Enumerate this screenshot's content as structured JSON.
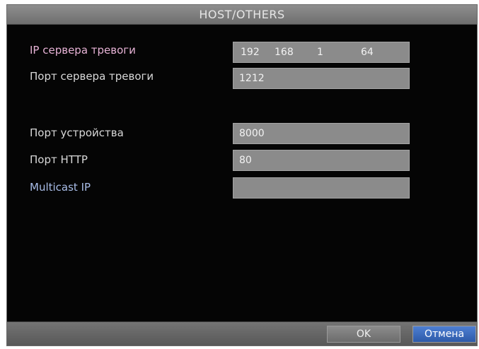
{
  "window": {
    "title": "HOST/OTHERS"
  },
  "fields": {
    "alarm_ip": {
      "label": "IP сервера тревоги",
      "octets": [
        "192",
        "168",
        "1",
        "64"
      ]
    },
    "alarm_port": {
      "label": "Порт сервера тревоги",
      "value": "1212"
    },
    "device_port": {
      "label": "Порт устройства",
      "value": "8000"
    },
    "http_port": {
      "label": "Порт HTTP",
      "value": "80"
    },
    "multicast_ip": {
      "label": "Multicast IP",
      "value": ""
    }
  },
  "buttons": {
    "ok": "OK",
    "cancel": "Отмена"
  }
}
